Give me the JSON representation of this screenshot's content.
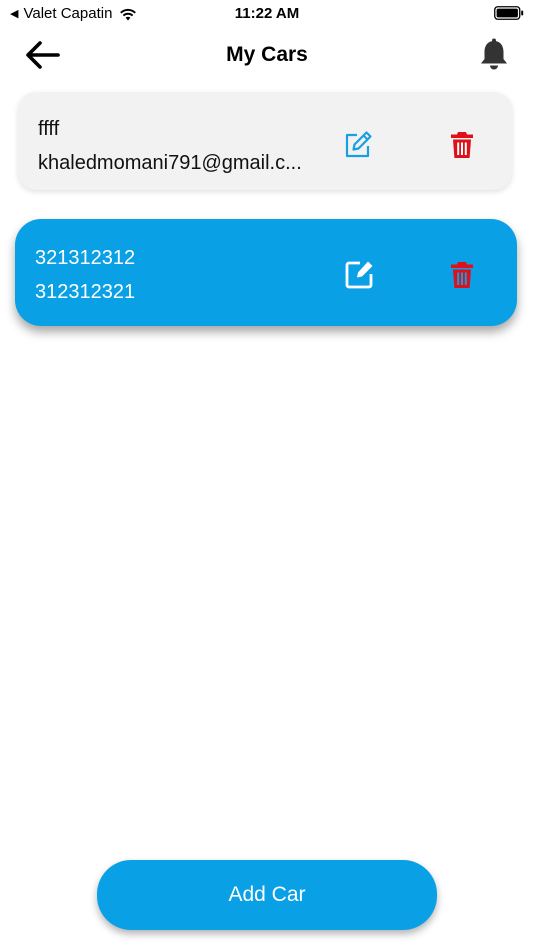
{
  "status_bar": {
    "back_app_label": "Valet Capatin",
    "time": "11:22 AM"
  },
  "header": {
    "title": "My Cars"
  },
  "cars": [
    {
      "line1": "ffff",
      "line2": "khaledmomani791@gmail.c..."
    },
    {
      "line1": "321312312",
      "line2": "312312321"
    }
  ],
  "colors": {
    "primary": "#0aa0e6",
    "delete": "#e0101a",
    "card_background": "#f2f2f2"
  },
  "footer": {
    "add_car_label": "Add Car"
  }
}
